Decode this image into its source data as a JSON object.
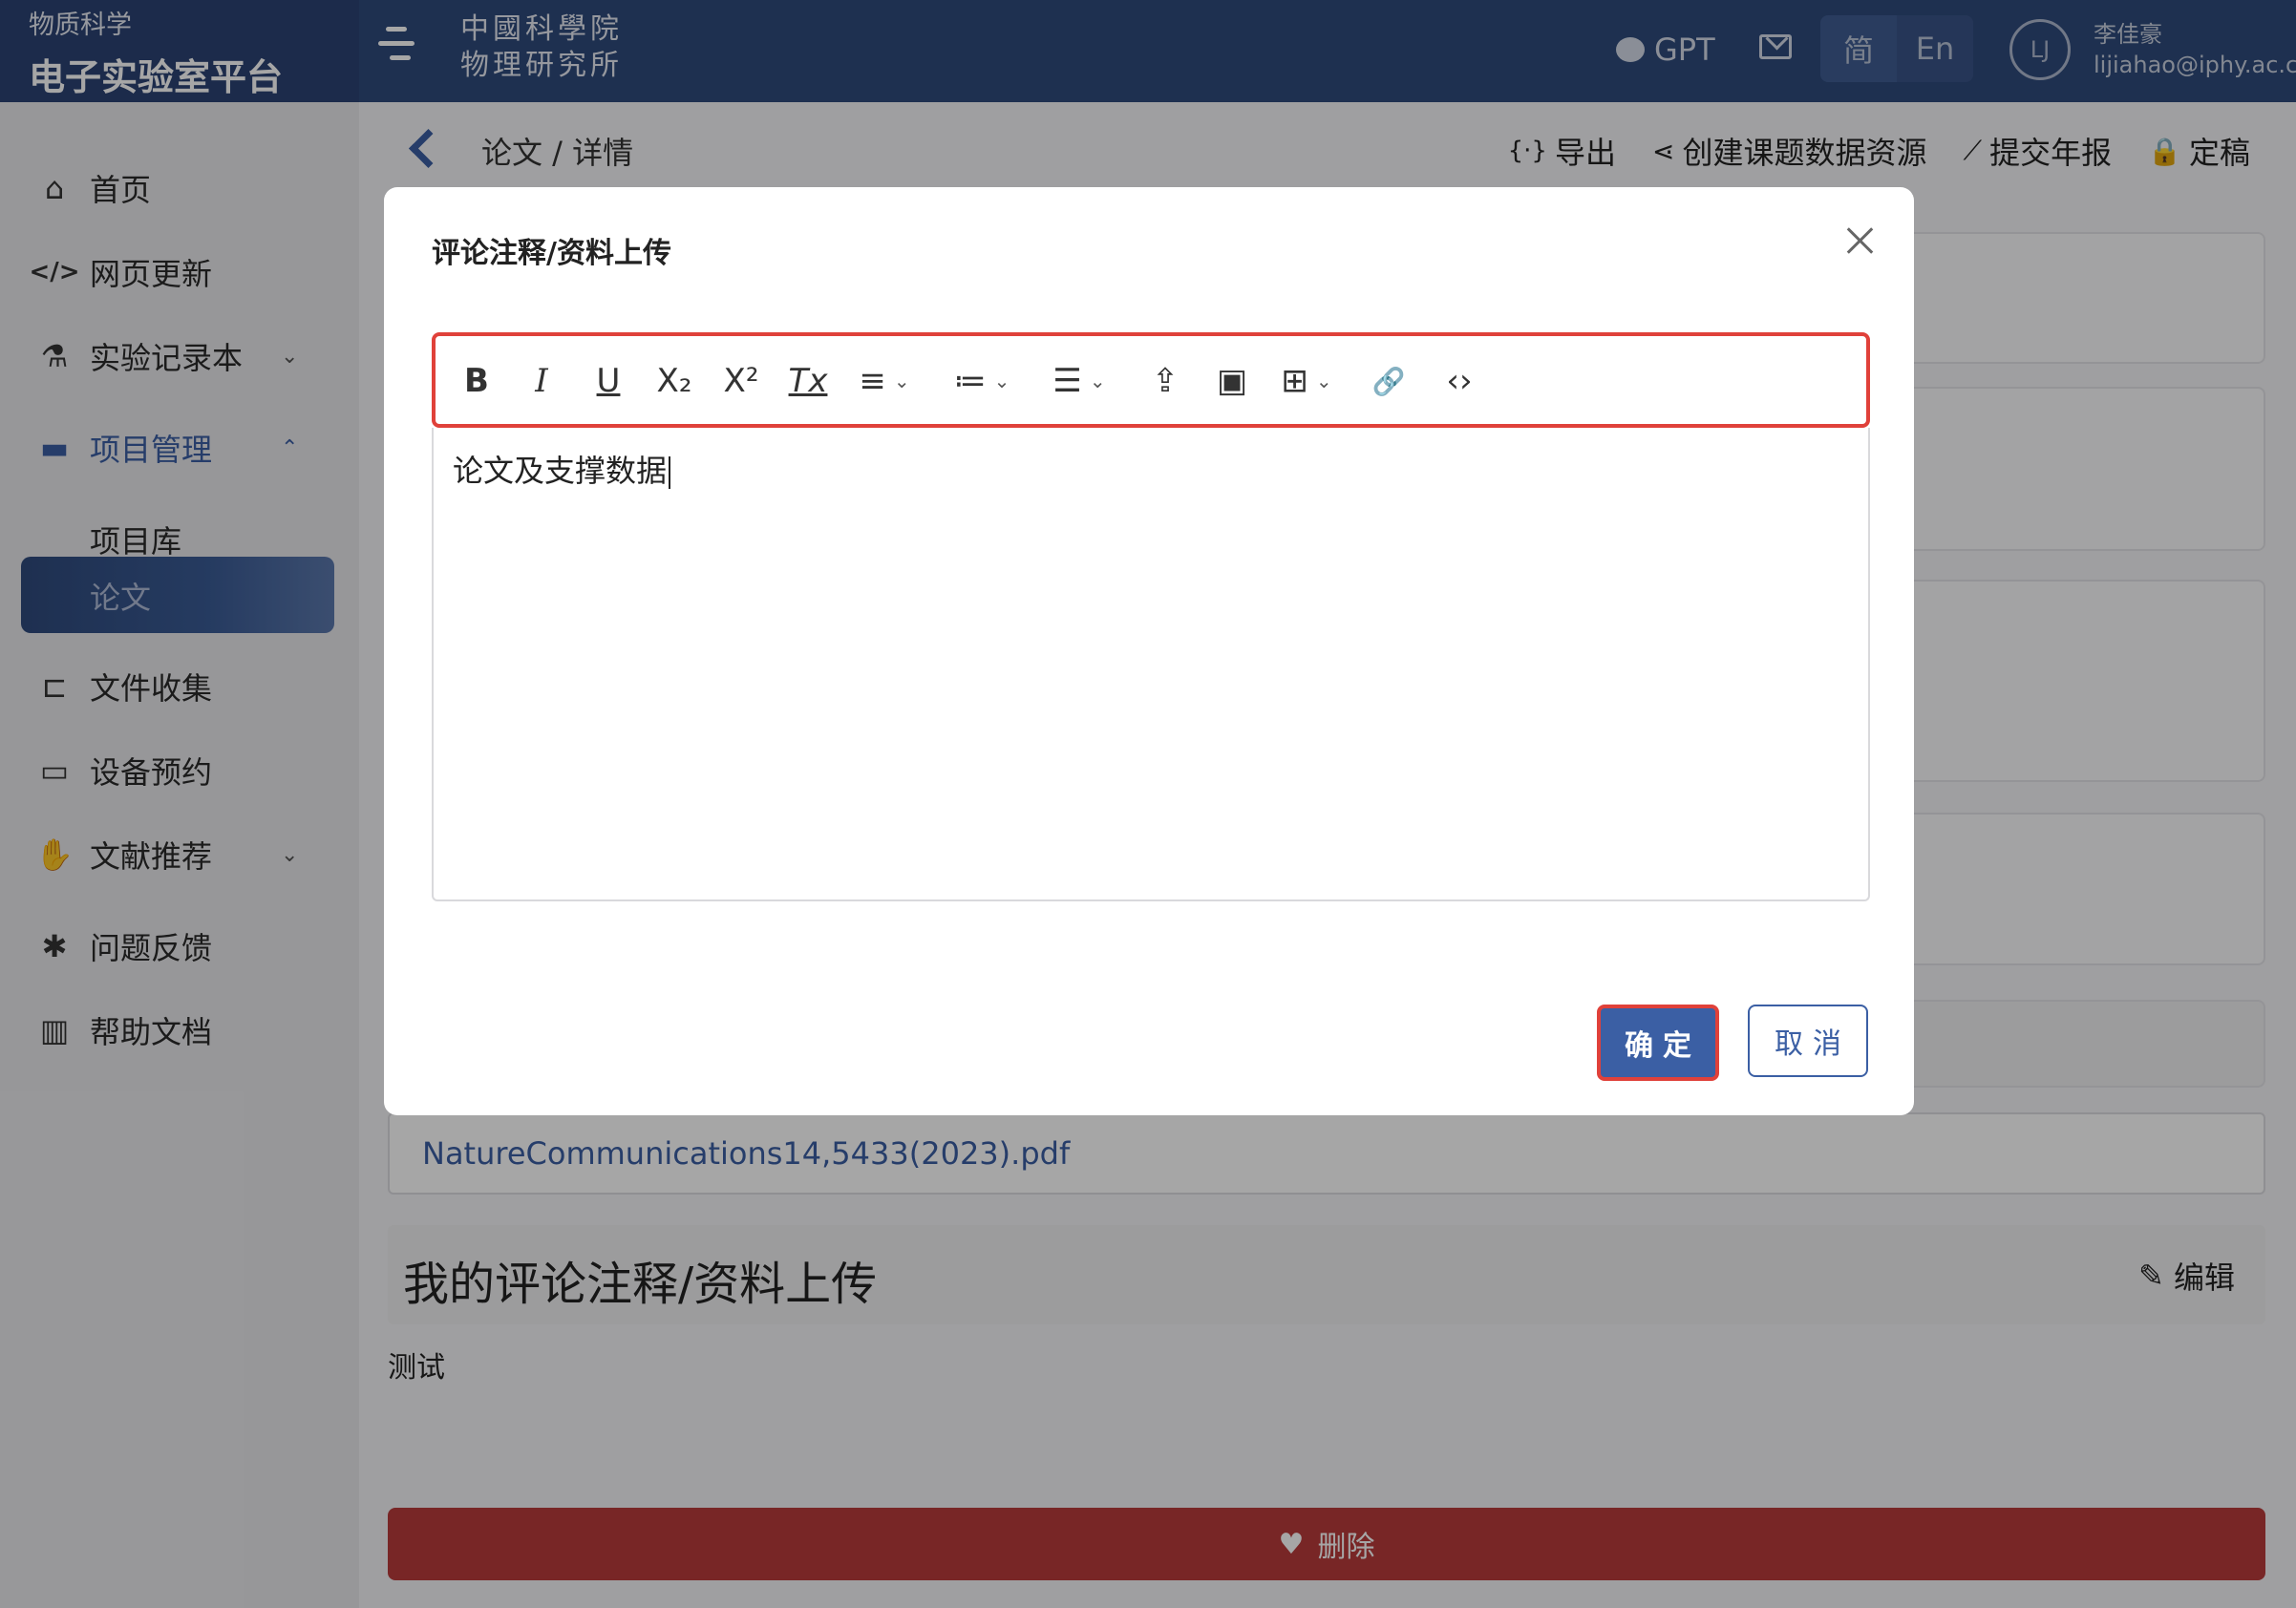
{
  "header": {
    "brand_sub": "物质科学",
    "brand_title": "电子实验室平台",
    "org_line1": "中國科學院",
    "org_line2": "物理研究所",
    "gpt_label": "GPT",
    "lang_zh": "简",
    "lang_en": "En",
    "avatar_initials": "LJ",
    "user_name": "李佳豪",
    "user_email": "lijiahao@iphy.ac.cn"
  },
  "sidebar": {
    "items": [
      {
        "label": "首页",
        "icon": "home-icon"
      },
      {
        "label": "网页更新",
        "icon": "code-icon"
      },
      {
        "label": "实验记录本",
        "icon": "flask-icon"
      },
      {
        "label": "项目管理",
        "icon": "folder-icon"
      },
      {
        "label": "项目库"
      },
      {
        "label": "论文"
      },
      {
        "label": "文件收集",
        "icon": "tree-icon"
      },
      {
        "label": "设备预约",
        "icon": "desktop-icon"
      },
      {
        "label": "文献推荐",
        "icon": "thumbs-up-icon"
      },
      {
        "label": "问题反馈",
        "icon": "bug-icon"
      },
      {
        "label": "帮助文档",
        "icon": "book-icon"
      }
    ]
  },
  "main": {
    "breadcrumb": "论文  /  详情",
    "actions": {
      "export": "导出",
      "create_resource": "创建课题数据资源",
      "submit_report": "提交年报",
      "finalize": "定稿"
    },
    "file_name": "NatureCommunications14,5433(2023).pdf",
    "my_section_title": "我的评论注释/资料上传",
    "edit_label": "编辑",
    "note_text": "测试",
    "delete_label": "删除"
  },
  "modal": {
    "title": "评论注释/资料上传",
    "editor_content": "论文及支撑数据",
    "toolbar": {
      "bold": "B",
      "italic": "I",
      "underline": "U",
      "subscript": "X₂",
      "superscript": "X²",
      "clear_format": "Tx",
      "align": "≡",
      "ordered_list": "≔",
      "bullet_list": "☰",
      "upload": "⇪",
      "image": "▣",
      "table": "⊞",
      "link": "🔗",
      "code": "‹›"
    },
    "confirm_label": "确定",
    "cancel_label": "取消"
  }
}
